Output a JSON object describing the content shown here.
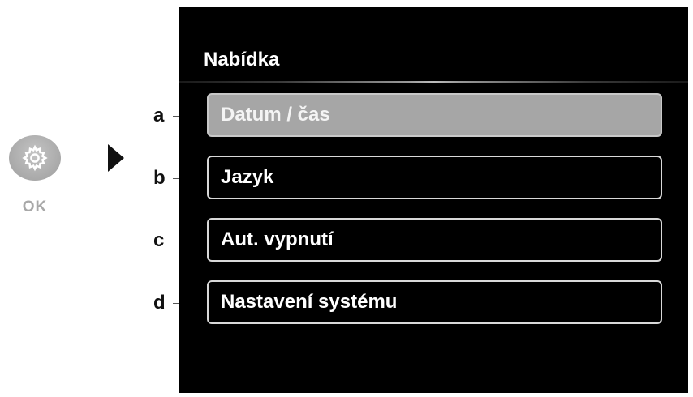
{
  "control": {
    "button_icon": "gear-icon",
    "ok_label": "OK",
    "pointer_icon": "play-arrow-icon"
  },
  "menu": {
    "title": "Nabídka",
    "items": [
      {
        "callout": "a",
        "label": "Datum / čas",
        "selected": true
      },
      {
        "callout": "b",
        "label": "Jazyk",
        "selected": false
      },
      {
        "callout": "c",
        "label": "Aut. vypnutí",
        "selected": false
      },
      {
        "callout": "d",
        "label": "Nastavení systému",
        "selected": false
      }
    ]
  },
  "colors": {
    "screen_background": "#000000",
    "selected_item_fill": "#a6a6a6",
    "item_border": "#d8d8d8",
    "text": "#ffffff"
  }
}
